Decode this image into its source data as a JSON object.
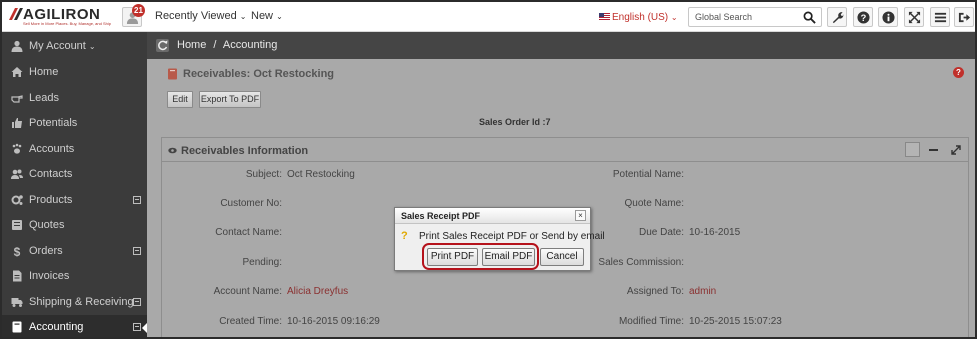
{
  "app": {
    "logo_text": "AGILIRON",
    "logo_tagline": "Sell More in More Places. Buy, Manage, and Ship",
    "notification_count": "21",
    "nav_recent": "Recently Viewed",
    "nav_new": "New",
    "language": "English (US)",
    "search_placeholder": "Global Search"
  },
  "toolbar_icons": [
    "wrench-icon",
    "help-icon",
    "info-icon",
    "expand-icon",
    "menu-icon",
    "logout-icon"
  ],
  "sidebar": {
    "account_label": "My Account",
    "items": [
      {
        "label": "Home",
        "icon": "home-icon",
        "expandable": false
      },
      {
        "label": "Leads",
        "icon": "hand-point-icon",
        "expandable": false
      },
      {
        "label": "Potentials",
        "icon": "thumbs-up-icon",
        "expandable": false
      },
      {
        "label": "Accounts",
        "icon": "paw-icon",
        "expandable": false
      },
      {
        "label": "Contacts",
        "icon": "contacts-icon",
        "expandable": false
      },
      {
        "label": "Products",
        "icon": "cogs-icon",
        "expandable": true
      },
      {
        "label": "Quotes",
        "icon": "quote-icon",
        "expandable": false
      },
      {
        "label": "Orders",
        "icon": "dollar-icon",
        "expandable": true
      },
      {
        "label": "Invoices",
        "icon": "invoice-icon",
        "expandable": false
      },
      {
        "label": "Shipping & Receiving",
        "icon": "truck-icon",
        "expandable": true
      },
      {
        "label": "Accounting",
        "icon": "book-icon",
        "expandable": true,
        "active": true
      }
    ]
  },
  "breadcrumb": {
    "home": "Home",
    "separator": "/",
    "current": "Accounting"
  },
  "page": {
    "title": "Receivables: Oct Restocking",
    "edit_label": "Edit",
    "export_label": "Export To PDF",
    "order_id": "Sales Order Id :7"
  },
  "panel": {
    "title": "Receivables Information",
    "left_fields": [
      {
        "label": "Subject:",
        "value": "Oct Restocking",
        "link": false
      },
      {
        "label": "Customer No:",
        "value": "",
        "link": false
      },
      {
        "label": "Contact Name:",
        "value": "",
        "link": false
      },
      {
        "label": "Pending:",
        "value": "",
        "link": false
      },
      {
        "label": "Account Name:",
        "value": "Alicia Dreyfus",
        "link": true
      },
      {
        "label": "Created Time:",
        "value": "10-16-2015 09:16:29",
        "link": false
      }
    ],
    "right_fields": [
      {
        "label": "Potential Name:",
        "value": "",
        "link": false
      },
      {
        "label": "Quote Name:",
        "value": "",
        "link": false
      },
      {
        "label": "Due Date:",
        "value": "10-16-2015",
        "link": false
      },
      {
        "label": "Sales Commission:",
        "value": "",
        "link": false
      },
      {
        "label": "Assigned To:",
        "value": "admin",
        "link": true
      },
      {
        "label": "Modified Time:",
        "value": "10-25-2015 15:07:23",
        "link": false
      }
    ]
  },
  "dialog": {
    "title": "Sales Receipt PDF",
    "close": "×",
    "message": "Print Sales Receipt PDF or Send by email",
    "print_label": "Print PDF",
    "email_label": "Email PDF",
    "cancel_label": "Cancel"
  },
  "colors": {
    "accent_red": "#c0302b",
    "sidebar_bg": "#3b3b3b",
    "overlay_gray": "#a9a9a9",
    "highlight": "#b5121b"
  }
}
